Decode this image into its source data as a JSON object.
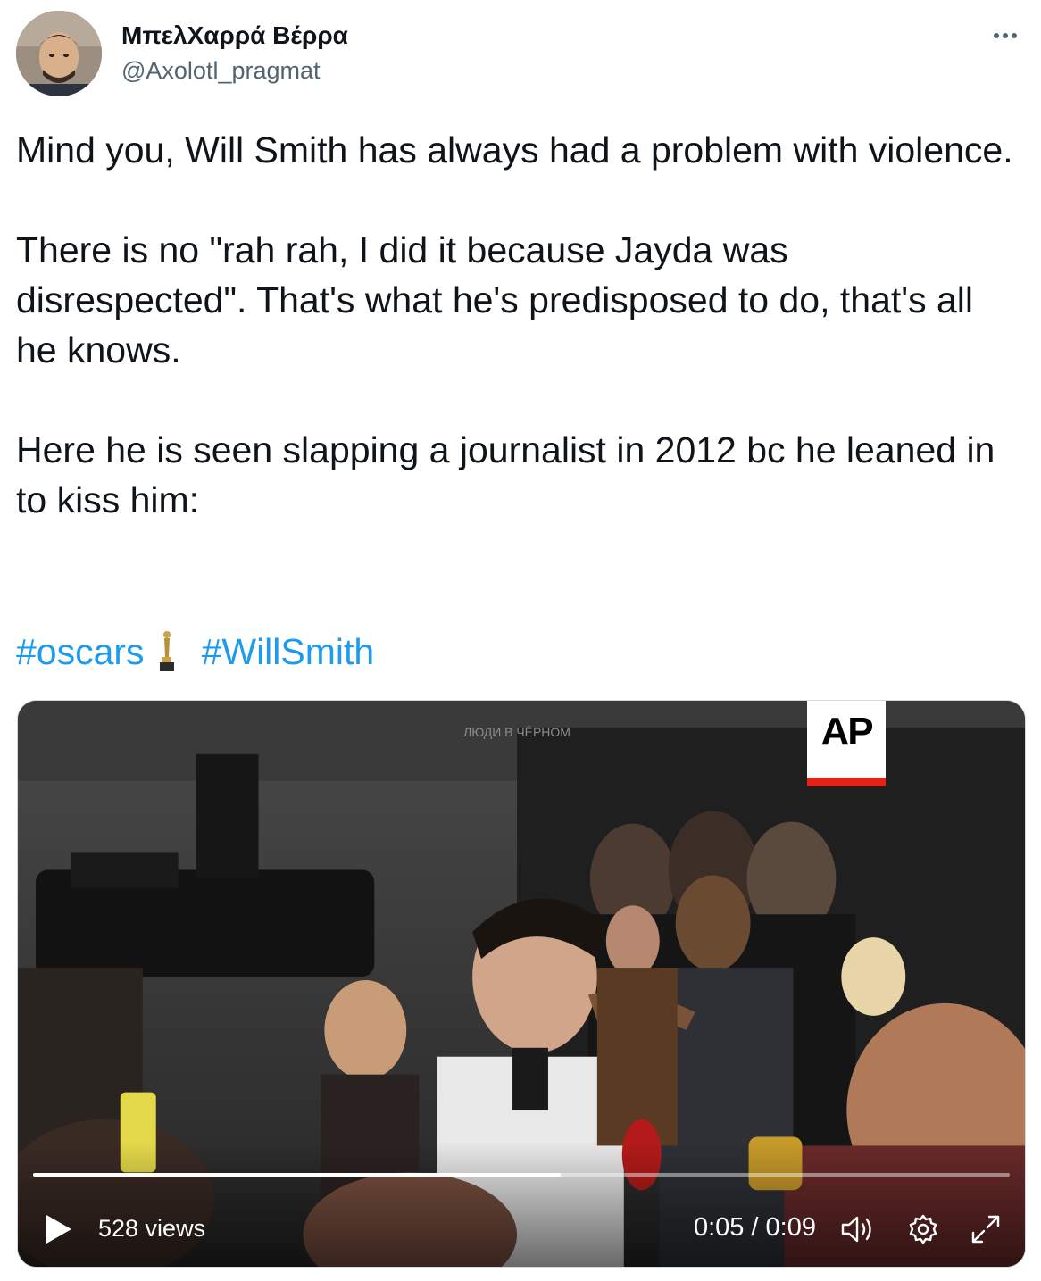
{
  "author": {
    "display_name": "ΜπελΧαρρά Βέρρα",
    "handle": "@Axolotl_pragmat"
  },
  "tweet": {
    "paragraphs": [
      "Mind you, Will Smith has always had a problem with violence.",
      "There is no \"rah rah, I did it because Jayda was disrespected\". That's what he's predisposed to do, that's all he knows.",
      "Here he is seen slapping a journalist in 2012 bc he leaned in to kiss him:"
    ],
    "hashtags": [
      "#oscars",
      "#WillSmith"
    ]
  },
  "media": {
    "watermark": "AP",
    "views": "528 views",
    "time": "0:05 / 0:09",
    "progress": 0.54,
    "background_signs": [
      "ЛЮДИ В ЧЁРНОМ"
    ]
  },
  "icons": {
    "more": "more-dots-icon",
    "hashtag_emoji": "oscar-statue-icon",
    "play": "play-icon",
    "volume": "volume-icon",
    "settings": "gear-icon",
    "fullscreen": "fullscreen-icon"
  },
  "colors": {
    "text": "#0f1419",
    "secondary": "#536471",
    "link": "#1d9bf0",
    "ap_red": "#e2231a"
  }
}
